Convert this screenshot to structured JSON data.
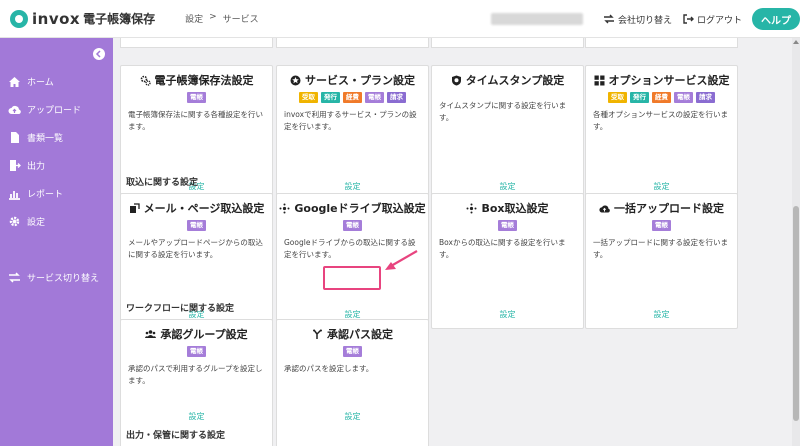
{
  "header": {
    "logo": "invox",
    "logo_sub": "電子帳簿保存",
    "breadcrumb": [
      "設定",
      ">",
      "サービス"
    ],
    "switch_company": "会社切り替え",
    "logout": "ログアウト",
    "help": "ヘルプ"
  },
  "sidebar": {
    "items": [
      {
        "label": "ホーム",
        "icon": "home-icon"
      },
      {
        "label": "アップロード",
        "icon": "cloud-upload-icon"
      },
      {
        "label": "書類一覧",
        "icon": "document-icon"
      },
      {
        "label": "出力",
        "icon": "export-icon"
      },
      {
        "label": "レポート",
        "icon": "chart-icon"
      },
      {
        "label": "設定",
        "icon": "gear-icon"
      },
      {
        "label": "サービス切り替え",
        "icon": "swap-icon"
      }
    ]
  },
  "tag_colors": {
    "電帳": "#a57dd9",
    "受取": "#f0b400",
    "発行": "#27b5a7",
    "経費": "#f07a2a",
    "請求": "#8a6cd1"
  },
  "row1": [
    {
      "title": "電子帳簿保存法設定",
      "icon": "gears-icon",
      "tags": [
        "電帳"
      ],
      "desc": "電子帳簿保存法に関する各種設定を行います。",
      "link": "設定"
    },
    {
      "title": "サービス・プラン設定",
      "icon": "star-icon",
      "tags": [
        "受取",
        "発行",
        "経費",
        "電帳",
        "請求"
      ],
      "desc": "invoxで利用するサービス・プランの設定を行います。",
      "link": "設定"
    },
    {
      "title": "タイムスタンプ設定",
      "icon": "shield-icon",
      "tags": [],
      "desc": "タイムスタンプに関する設定を行います。",
      "link": "設定"
    },
    {
      "title": "オプションサービス設定",
      "icon": "grid-icon",
      "tags": [
        "受取",
        "発行",
        "経費",
        "電帳",
        "請求"
      ],
      "desc": "各種オプションサービスの設定を行います。",
      "link": "設定"
    }
  ],
  "section_import": "取込に関する設定",
  "row2": [
    {
      "title": "メール・ページ取込設定",
      "icon": "mail-icon",
      "tags": [
        "電帳"
      ],
      "desc": "メールやアップロードページからの取込に関する設定を行います。",
      "link": "設定"
    },
    {
      "title": "Googleドライブ取込設定",
      "icon": "link-icon",
      "tags": [
        "電帳"
      ],
      "desc": "Googleドライブからの取込に関する設定を行います。",
      "link": "設定"
    },
    {
      "title": "Box取込設定",
      "icon": "link-icon",
      "tags": [
        "電帳"
      ],
      "desc": "Boxからの取込に関する設定を行います。",
      "link": "設定"
    },
    {
      "title": "一括アップロード設定",
      "icon": "cloud-upload-icon",
      "tags": [
        "電帳"
      ],
      "desc": "一括アップロードに関する設定を行います。",
      "link": "設定"
    }
  ],
  "section_workflow": "ワークフローに関する設定",
  "row3": [
    {
      "title": "承認グループ設定",
      "icon": "users-icon",
      "tags": [
        "電帳"
      ],
      "desc": "承認のパスで利用するグループを設定します。",
      "link": "設定"
    },
    {
      "title": "承認パス設定",
      "icon": "path-icon",
      "tags": [
        "電帳"
      ],
      "desc": "承認のパスを設定します。",
      "link": "設定"
    }
  ],
  "section_output": "出力・保管に関する設定"
}
